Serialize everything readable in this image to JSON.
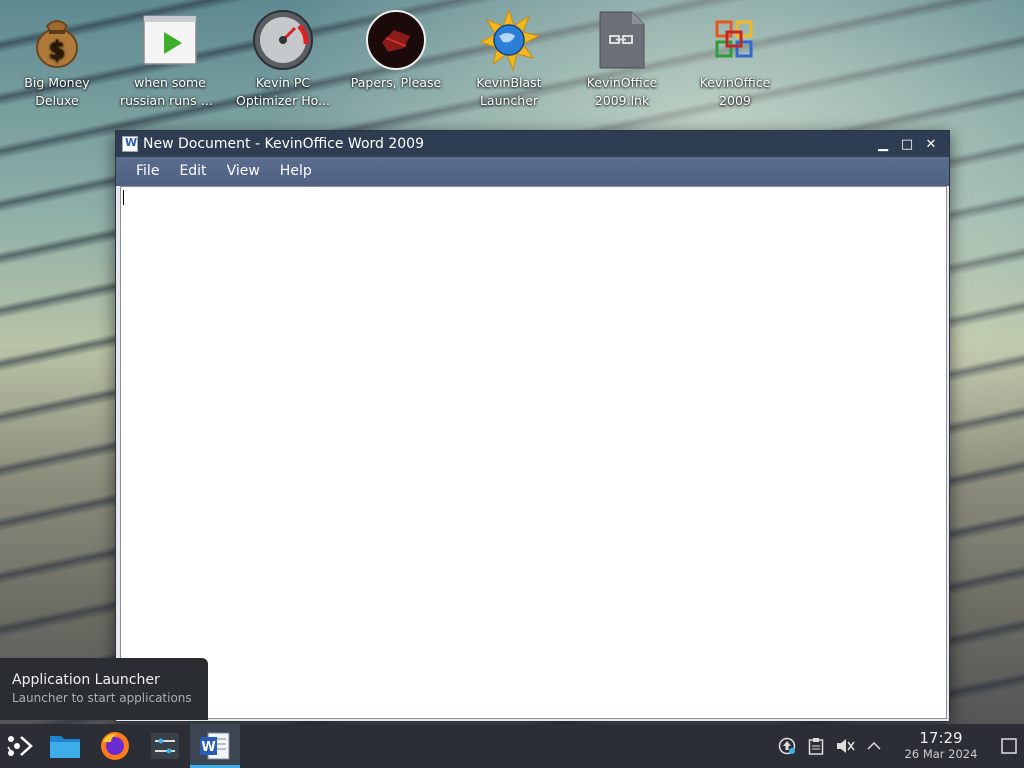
{
  "desktop": {
    "icons": [
      {
        "label_1": "Big Money",
        "label_2": "Deluxe",
        "icon": "money-bag-icon"
      },
      {
        "label_1": "when some",
        "label_2": "russian runs a...",
        "icon": "video-player-icon"
      },
      {
        "label_1": "Kevin PC",
        "label_2": "Optimizer Ho...",
        "icon": "speedometer-icon"
      },
      {
        "label_1": "Papers, Please",
        "label_2": "",
        "icon": "papers-please-icon"
      },
      {
        "label_1": "KevinBlast",
        "label_2": "Launcher",
        "icon": "globe-sun-icon"
      },
      {
        "label_1": "KevinOffice",
        "label_2": "2009.lnk",
        "icon": "shortcut-file-icon"
      },
      {
        "label_1": "KevinOffice",
        "label_2": "2009",
        "icon": "office-logo-icon"
      }
    ]
  },
  "window": {
    "title": "New Document - KevinOffice Word 2009",
    "minimize": "▁",
    "maximize": "□",
    "close": "✕",
    "menu": [
      "File",
      "Edit",
      "View",
      "Help"
    ]
  },
  "tooltip": {
    "title": "Application Launcher",
    "subtitle": "Launcher to start applications"
  },
  "taskbar": {
    "time": "17:29",
    "date": "26 Mar 2024"
  },
  "colors": {
    "accent": "#3daee9",
    "titlebar": "#2f3d52",
    "menubar": "#55678a",
    "taskbar": "#2b2f35"
  }
}
